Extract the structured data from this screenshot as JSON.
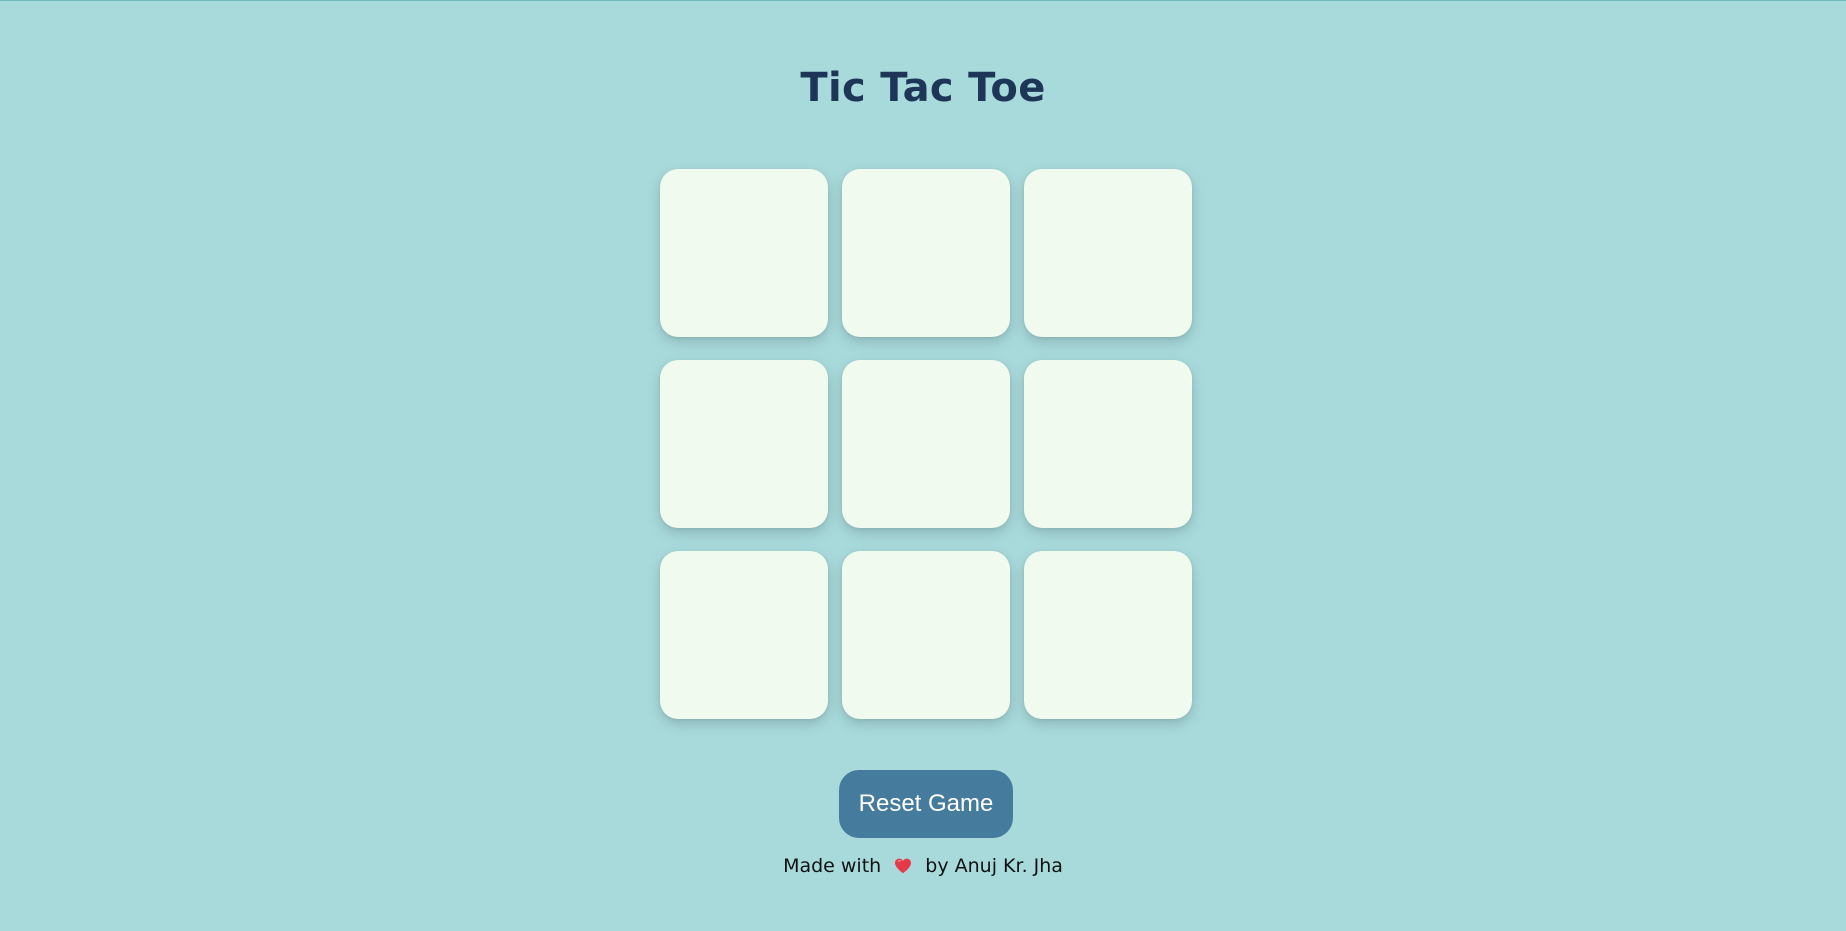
{
  "header": {
    "title": "Tic Tac Toe"
  },
  "board": {
    "cells": [
      "",
      "",
      "",
      "",
      "",
      "",
      "",
      "",
      ""
    ]
  },
  "controls": {
    "reset_label": "Reset Game"
  },
  "footer": {
    "prefix": "Made with",
    "icon": "heart-icon",
    "suffix": "by Anuj Kr. Jha"
  },
  "colors": {
    "background": "#a8dadc",
    "title": "#1d3557",
    "cell": "#f1faee",
    "button": "#457b9d",
    "heart": "#e63946"
  }
}
